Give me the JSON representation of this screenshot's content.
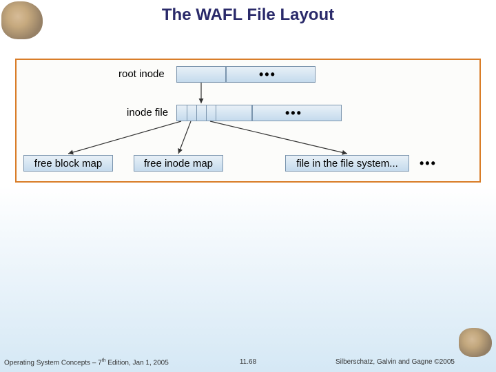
{
  "title": "The WAFL File Layout",
  "diagram": {
    "root_inode_label": "root inode",
    "inode_file_label": "inode file",
    "free_block_map_label": "free block map",
    "free_inode_map_label": "free inode map",
    "file_in_fs_label": "file in the file system...",
    "ellipsis": "•••"
  },
  "footer": {
    "left_prefix": "Operating System Concepts – 7",
    "left_sup": "th",
    "left_suffix": " Edition, Jan 1, 2005",
    "center": "11.68",
    "right": "Silberschatz, Galvin and Gagne ©2005"
  }
}
